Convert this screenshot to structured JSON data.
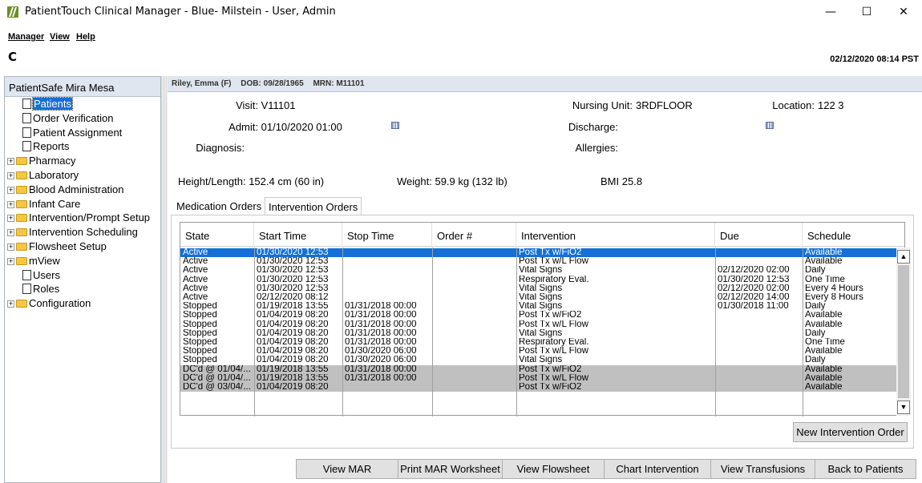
{
  "window": {
    "title": "PatientTouch Clinical Manager - Blue- Milstein - User, Admin",
    "minimize": "—",
    "maximize": "☐",
    "close": "✕"
  },
  "menu": {
    "manager": "Manager",
    "view": "View",
    "help": "Help"
  },
  "toolbar": {
    "refresh_glyph": "C",
    "datetime": "02/12/2020 08:14 PST"
  },
  "sidebar": {
    "facility": "PatientSafe Mira Mesa",
    "items": [
      {
        "label": "Patients",
        "kind": "doc",
        "selected": true
      },
      {
        "label": "Order Verification",
        "kind": "doc"
      },
      {
        "label": "Patient Assignment",
        "kind": "doc"
      },
      {
        "label": "Reports",
        "kind": "doc"
      },
      {
        "label": "Pharmacy",
        "kind": "folder"
      },
      {
        "label": "Laboratory",
        "kind": "folder"
      },
      {
        "label": "Blood Administration",
        "kind": "folder"
      },
      {
        "label": "Infant Care",
        "kind": "folder"
      },
      {
        "label": "Intervention/Prompt Setup",
        "kind": "folder"
      },
      {
        "label": "Intervention Scheduling",
        "kind": "folder"
      },
      {
        "label": "Flowsheet Setup",
        "kind": "folder"
      },
      {
        "label": "mView",
        "kind": "folder"
      },
      {
        "label": "Users",
        "kind": "doc"
      },
      {
        "label": "Roles",
        "kind": "doc"
      },
      {
        "label": "Configuration",
        "kind": "folder"
      }
    ]
  },
  "patient": {
    "name": "Riley, Emma",
    "sex": "(F)",
    "dob": "DOB: 09/28/1965",
    "mrn": "MRN: M11101",
    "visit_label": "Visit:",
    "visit": "V11101",
    "nursing_unit_label": "Nursing Unit:",
    "nursing_unit": "3RDFLOOR",
    "location_label": "Location:",
    "location": "122 3",
    "admit_label": "Admit:",
    "admit": "01/10/2020 01:00",
    "discharge_label": "Discharge:",
    "discharge": "",
    "diagnosis_label": "Diagnosis:",
    "diagnosis": "",
    "allergies_label": "Allergies:",
    "allergies": "",
    "height_label": "Height/Length:",
    "height": "152.4 cm (60 in)",
    "weight_label": "Weight:",
    "weight": "59.9 kg (132 lb)",
    "bmi_label": "BMI",
    "bmi": "25.8"
  },
  "tabs": {
    "medication": "Medication Orders",
    "intervention": "Intervention Orders"
  },
  "table": {
    "headers": [
      "State",
      "Start Time",
      "Stop Time",
      "Order #",
      "Intervention",
      "Due",
      "Schedule"
    ],
    "rows": [
      {
        "state": "Active",
        "start": "01/30/2020 12:53",
        "stop": "",
        "order": "",
        "intervention": "Post Tx w/FiO2",
        "due": "",
        "schedule": "Available",
        "style": "sel"
      },
      {
        "state": "Active",
        "start": "01/30/2020 12:53",
        "stop": "",
        "order": "",
        "intervention": "Post Tx w/L Flow",
        "due": "",
        "schedule": "Available",
        "style": ""
      },
      {
        "state": "Active",
        "start": "01/30/2020 12:53",
        "stop": "",
        "order": "",
        "intervention": "Vital Signs",
        "due": "02/12/2020 02:00",
        "schedule": "Daily",
        "style": ""
      },
      {
        "state": "Active",
        "start": "01/30/2020 12:53",
        "stop": "",
        "order": "",
        "intervention": "Respiratory Eval.",
        "due": "01/30/2020 12:53",
        "schedule": "One Time",
        "style": ""
      },
      {
        "state": "Active",
        "start": "01/30/2020 12:53",
        "stop": "",
        "order": "",
        "intervention": "Vital Signs",
        "due": "02/12/2020 02:00",
        "schedule": "Every  4 Hours",
        "style": ""
      },
      {
        "state": "Active",
        "start": "02/12/2020 08:12",
        "stop": "",
        "order": "",
        "intervention": "Vital Signs",
        "due": "02/12/2020 14:00",
        "schedule": "Every 8 Hours",
        "style": ""
      },
      {
        "state": "Stopped",
        "start": "01/19/2018 13:55",
        "stop": "01/31/2018 00:00",
        "order": "",
        "intervention": "Vital Signs",
        "due": "01/30/2018 11:00",
        "schedule": "Daily",
        "style": ""
      },
      {
        "state": "Stopped",
        "start": "01/04/2019 08:20",
        "stop": "01/31/2018 00:00",
        "order": "",
        "intervention": "Post Tx w/FiO2",
        "due": "",
        "schedule": "Available",
        "style": ""
      },
      {
        "state": "Stopped",
        "start": "01/04/2019 08:20",
        "stop": "01/31/2018 00:00",
        "order": "",
        "intervention": "Post Tx w/L Flow",
        "due": "",
        "schedule": "Available",
        "style": ""
      },
      {
        "state": "Stopped",
        "start": "01/04/2019 08:20",
        "stop": "01/31/2018 00:00",
        "order": "",
        "intervention": "Vital Signs",
        "due": "",
        "schedule": "Daily",
        "style": ""
      },
      {
        "state": "Stopped",
        "start": "01/04/2019 08:20",
        "stop": "01/31/2018 00:00",
        "order": "",
        "intervention": "Respiratory Eval.",
        "due": "",
        "schedule": "One Time",
        "style": ""
      },
      {
        "state": "Stopped",
        "start": "01/04/2019 08:20",
        "stop": "01/30/2020 06:00",
        "order": "",
        "intervention": "Post Tx w/L Flow",
        "due": "",
        "schedule": "Available",
        "style": ""
      },
      {
        "state": "Stopped",
        "start": "01/04/2019 08:20",
        "stop": "01/30/2020 06:00",
        "order": "",
        "intervention": "Vital Signs",
        "due": "",
        "schedule": "Daily",
        "style": ""
      },
      {
        "state": "DC'd @ 01/04/...",
        "start": "01/19/2018 13:55",
        "stop": "01/31/2018 00:00",
        "order": "",
        "intervention": "Post Tx w/FiO2",
        "due": "",
        "schedule": "Available",
        "style": "dc"
      },
      {
        "state": "DC'd @ 01/04/...",
        "start": "01/19/2018 13:55",
        "stop": "01/31/2018 00:00",
        "order": "",
        "intervention": "Post Tx w/L Flow",
        "due": "",
        "schedule": "Available",
        "style": "dc"
      },
      {
        "state": "DC'd @ 03/04/...",
        "start": "01/04/2019 08:20",
        "stop": "",
        "order": "",
        "intervention": "Post Tx w/FiO2",
        "due": "",
        "schedule": "Available",
        "style": "dc"
      }
    ]
  },
  "buttons": {
    "new_intervention": "New Intervention Order",
    "view_mar": "View MAR",
    "print_mar": "Print MAR Worksheet",
    "view_flowsheet": "View Flowsheet",
    "chart_intervention": "Chart Intervention",
    "view_transfusions": "View Transfusions",
    "back_to_patients": "Back to Patients"
  },
  "scrollbar": {
    "up_glyph": "▲",
    "down_glyph": "▼"
  }
}
